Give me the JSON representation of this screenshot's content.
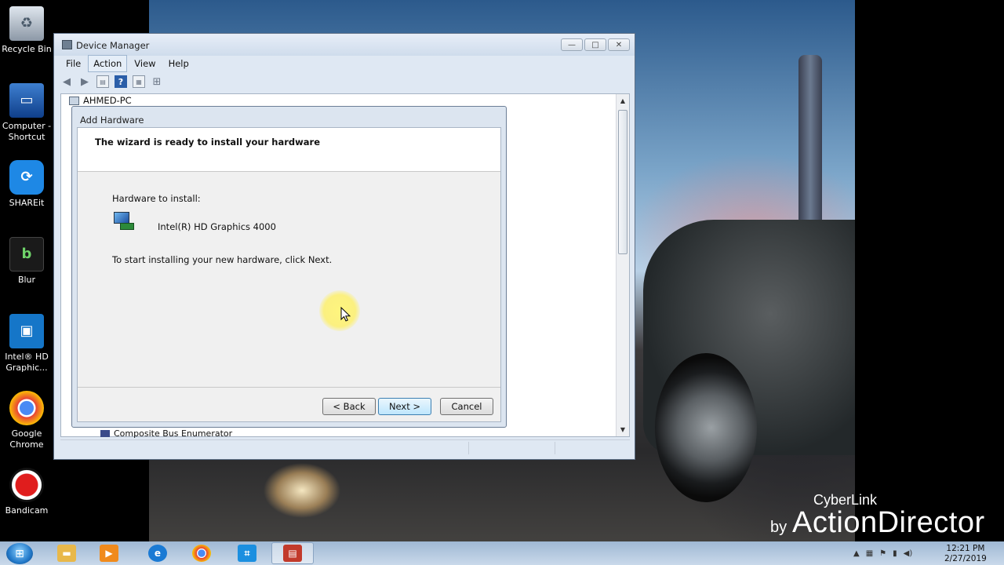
{
  "desktop": {
    "icons": [
      {
        "label": "Recycle Bin",
        "icon": "recycle-bin-icon"
      },
      {
        "label": "Computer - Shortcut",
        "icon": "computer-icon"
      },
      {
        "label": "SHAREit",
        "icon": "shareit-icon"
      },
      {
        "label": "Blur",
        "icon": "blur-icon"
      },
      {
        "label": "Intel® HD Graphic...",
        "icon": "intel-graphics-icon"
      },
      {
        "label": "Google Chrome",
        "icon": "chrome-icon"
      },
      {
        "label": "Bandicam",
        "icon": "bandicam-icon"
      }
    ]
  },
  "device_manager": {
    "title": "Device Manager",
    "window_buttons": {
      "minimize": "—",
      "maximize": "□",
      "close": "✕"
    },
    "menu": [
      "File",
      "Action",
      "View",
      "Help"
    ],
    "active_menu": "Action",
    "toolbar": [
      "back-arrow-icon",
      "forward-arrow-icon",
      "properties-icon",
      "help-icon",
      "view-icon",
      "scan-hardware-icon"
    ],
    "tree_root": "AHMED-PC",
    "tree_visible_bottom_item": "Composite Bus Enumerator"
  },
  "dialog": {
    "title": "Add Hardware",
    "heading": "The wizard is ready to install your hardware",
    "hardware_label": "Hardware to install:",
    "hardware_name": "Intel(R) HD Graphics 4000",
    "instruction": "To start installing your new hardware, click Next.",
    "buttons": {
      "back": "< Back",
      "next": "Next >",
      "cancel": "Cancel"
    }
  },
  "watermark": {
    "top": "CyberLink",
    "by": "by",
    "brand": "ActionDirector"
  },
  "taskbar": {
    "apps": [
      "file-explorer-icon",
      "media-player-icon",
      "internet-explorer-icon",
      "chrome-icon",
      "screen-capture-icon",
      "device-manager-icon"
    ],
    "active_app": "device-manager-icon",
    "clock_time": "12:21 PM",
    "clock_date": "2/27/2019"
  }
}
